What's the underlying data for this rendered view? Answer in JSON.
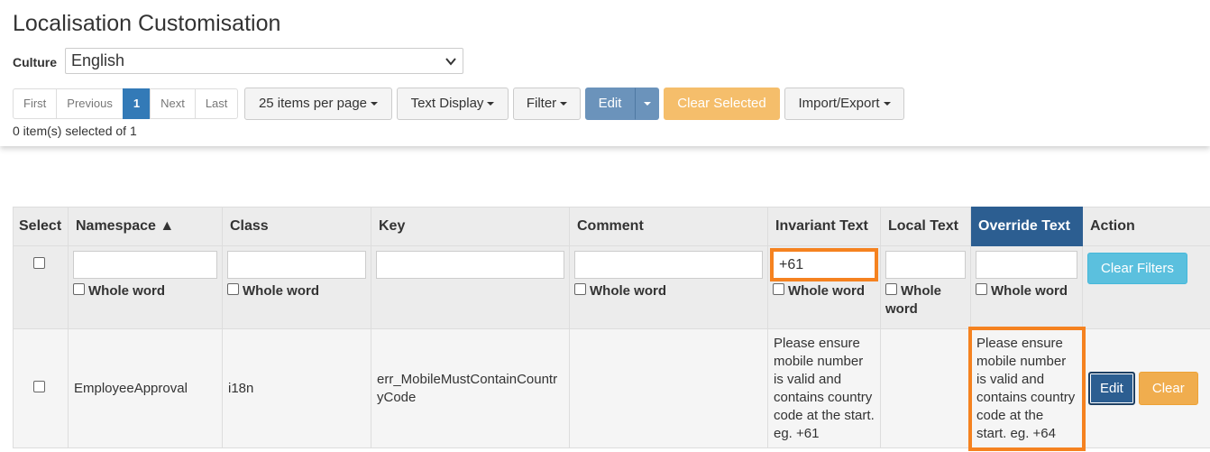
{
  "page": {
    "title": "Localisation Customisation"
  },
  "culture": {
    "label": "Culture",
    "value": "English"
  },
  "pager": {
    "first": "First",
    "previous": "Previous",
    "current": "1",
    "next": "Next",
    "last": "Last"
  },
  "toolbar": {
    "per_page": "25 items per page",
    "text_display": "Text Display",
    "filter": "Filter",
    "edit": "Edit",
    "clear_selected": "Clear Selected",
    "import_export": "Import/Export"
  },
  "selected_info": "0 item(s) selected of 1",
  "table": {
    "headers": {
      "select": "Select",
      "namespace": "Namespace ▲",
      "class": "Class",
      "key": "Key",
      "comment": "Comment",
      "invariant": "Invariant Text",
      "local": "Local Text",
      "override": "Override Text",
      "action": "Action"
    },
    "filters": {
      "whole_word": "Whole word",
      "namespace": "",
      "class": "",
      "key": "",
      "comment": "",
      "invariant": "+61",
      "local": "",
      "override": "",
      "clear_filters": "Clear Filters"
    },
    "rows": [
      {
        "namespace": "EmployeeApproval",
        "class": "i18n",
        "key": "err_MobileMustContainCountryCode",
        "comment": "",
        "invariant": "Please ensure mobile number is valid and contains country code at the start. eg. +61",
        "local": "",
        "override": "Please ensure mobile number is valid and contains country code at the start. eg. +64",
        "edit": "Edit",
        "clear": "Clear"
      }
    ]
  },
  "colors": {
    "primary": "#337ab7",
    "override_header": "#2c5e91",
    "highlight": "#f58220",
    "warning": "#f0ad4e",
    "info": "#5bc0de"
  }
}
